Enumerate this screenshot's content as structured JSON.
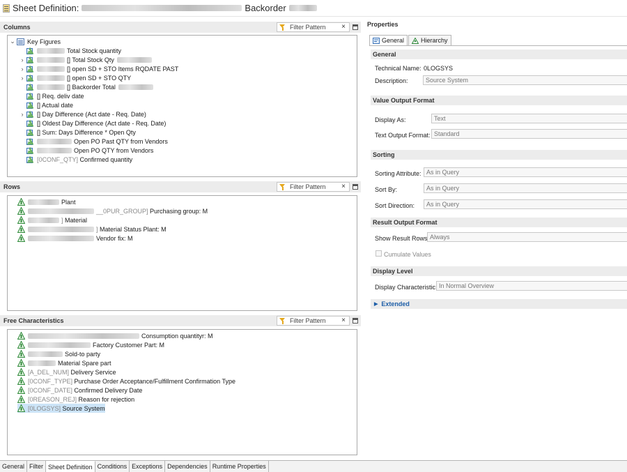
{
  "window": {
    "title": "Sheet Definition:",
    "title_suffix": "Backorder"
  },
  "columns_panel": {
    "title": "Columns",
    "filter_placeholder": "Filter Pattern",
    "root": "Key Figures",
    "items": [
      {
        "tech": "",
        "label": "Total Stock quantity",
        "expandable": false
      },
      {
        "tech": "",
        "label": "[] Total Stock Qty",
        "expandable": true
      },
      {
        "tech": "",
        "label": "[] open SD + STO Items RQDATE PAST",
        "expandable": true
      },
      {
        "tech": "",
        "label": "[] open SD + STO QTY",
        "expandable": true
      },
      {
        "tech": "",
        "label": "[] Backorder Total",
        "expandable": false
      },
      {
        "tech": "",
        "label": "[] Req. deliv date",
        "expandable": false
      },
      {
        "tech": "",
        "label": "[] Actual date",
        "expandable": false
      },
      {
        "tech": "",
        "label": "[] Day Difference (Act date - Req. Date)",
        "expandable": true
      },
      {
        "tech": "",
        "label": "[] Oldest Day Difference (Act date - Req. Date)",
        "expandable": false
      },
      {
        "tech": "",
        "label": "[] Sum: Days Difference * Open Qty",
        "expandable": false
      },
      {
        "tech": "",
        "label": "Open PO Past QTY from Vendors",
        "expandable": false
      },
      {
        "tech": "",
        "label": "Open PO QTY from Vendors",
        "expandable": false
      },
      {
        "tech": "[0CONF_QTY]",
        "label": "Confirmed quantity",
        "expandable": false
      }
    ]
  },
  "rows_panel": {
    "title": "Rows",
    "filter_placeholder": "Filter Pattern",
    "items": [
      {
        "tech": "",
        "label": "Plant"
      },
      {
        "tech": "__0PUR_GROUP]",
        "label": "Purchasing group: M"
      },
      {
        "tech": "]",
        "label": "Material"
      },
      {
        "tech": "]",
        "label": "Material Status Plant: M"
      },
      {
        "tech": "",
        "label": "Vendor fix: M"
      }
    ]
  },
  "free_panel": {
    "title": "Free Characteristics",
    "filter_placeholder": "Filter Pattern",
    "items": [
      {
        "tech": "",
        "label": "Consumption quantityr: M"
      },
      {
        "tech": "",
        "label": "Factory Customer Part: M"
      },
      {
        "tech": "",
        "label": "Sold-to party"
      },
      {
        "tech": "",
        "label": "Material Spare part"
      },
      {
        "tech": "[A_DEL_NUM]",
        "label": "Delivery Service"
      },
      {
        "tech": "[0CONF_TYPE]",
        "label": "Purchase Order Acceptance/Fulfillment Confirmation Type"
      },
      {
        "tech": "[0CONF_DATE]",
        "label": "Confirmed Delivery Date"
      },
      {
        "tech": "[0REASON_REJ]",
        "label": "Reason for rejection"
      },
      {
        "tech": "[0LOGSYS]",
        "label": "Source System"
      }
    ]
  },
  "bottom_tabs": [
    "General",
    "Filter",
    "Sheet Definition",
    "Conditions",
    "Exceptions",
    "Dependencies",
    "Runtime Properties"
  ],
  "properties": {
    "title": "Properties",
    "tabs": [
      "General",
      "Hierarchy"
    ],
    "general": {
      "section": "General",
      "technical_name_label": "Technical Name:",
      "technical_name_value": "0LOGSYS",
      "description_label": "Description:",
      "description_value": "Source System"
    },
    "value_output": {
      "section": "Value Output Format",
      "display_as_label": "Display As:",
      "display_as_value": "Text",
      "text_output_label": "Text Output Format:",
      "text_output_value": "Standard"
    },
    "sorting": {
      "section": "Sorting",
      "attr_label": "Sorting Attribute:",
      "attr_value": "As in Query",
      "by_label": "Sort By:",
      "by_value": "As in Query",
      "dir_label": "Sort Direction:",
      "dir_value": "As in Query"
    },
    "result_output": {
      "section": "Result Output Format",
      "show_rows_label": "Show Result Rows:",
      "show_rows_value": "Always",
      "cumulate_label": "Cumulate Values"
    },
    "display_level": {
      "section": "Display Level",
      "char_label": "Display Characteristic:",
      "char_value": "In Normal Overview"
    },
    "extended_label": "Extended"
  },
  "colors": {
    "selection": "#cce4f7",
    "accent": "#1f5fa8",
    "section_bg": "#ececec"
  }
}
